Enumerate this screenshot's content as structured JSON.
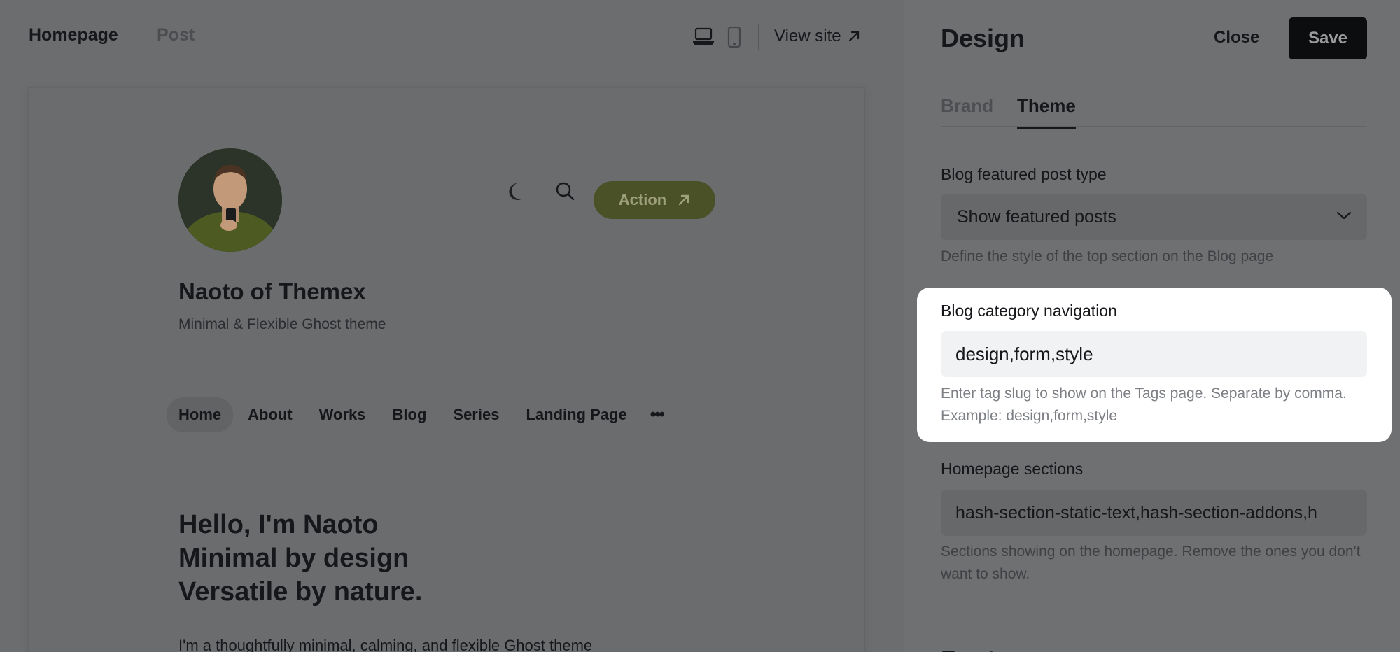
{
  "preview": {
    "tabs": {
      "homepage": "Homepage",
      "post": "Post"
    },
    "view_site": "View site",
    "site": {
      "title": "Naoto of Themex",
      "description": "Minimal & Flexible Ghost theme",
      "action_label": "Action",
      "nav": [
        "Home",
        "About",
        "Works",
        "Blog",
        "Series",
        "Landing Page"
      ],
      "nav_more": "•••",
      "hero": [
        "Hello, I'm Naoto",
        "Minimal by design",
        "Versatile by nature."
      ],
      "intro": "I'm a thoughtfully minimal, calming, and flexible Ghost theme"
    }
  },
  "panel": {
    "title": "Design",
    "close_label": "Close",
    "save_label": "Save",
    "tabs": {
      "brand": "Brand",
      "theme": "Theme"
    },
    "active_tab": "Theme",
    "fields": {
      "featured": {
        "label": "Blog featured post type",
        "value": "Show featured posts",
        "help": "Define the style of the top section on the Blog page"
      },
      "category_nav": {
        "label": "Blog category navigation",
        "value": "design,form,style",
        "help": "Enter tag slug to show on the Tags page. Separate by comma. Example: design,form,style"
      },
      "homepage_sections": {
        "label": "Homepage sections",
        "value": "hash-section-static-text,hash-section-addons,h",
        "help": "Sections showing on the homepage. Remove the ones you don't want to show."
      }
    },
    "next_section_partial": "Post"
  },
  "colors": {
    "overlay": "#6f7072",
    "action_button": "#4a5127",
    "save_button": "#0c0d0e",
    "highlight_card": "#ffffff",
    "highlight_input": "#f1f2f3"
  }
}
